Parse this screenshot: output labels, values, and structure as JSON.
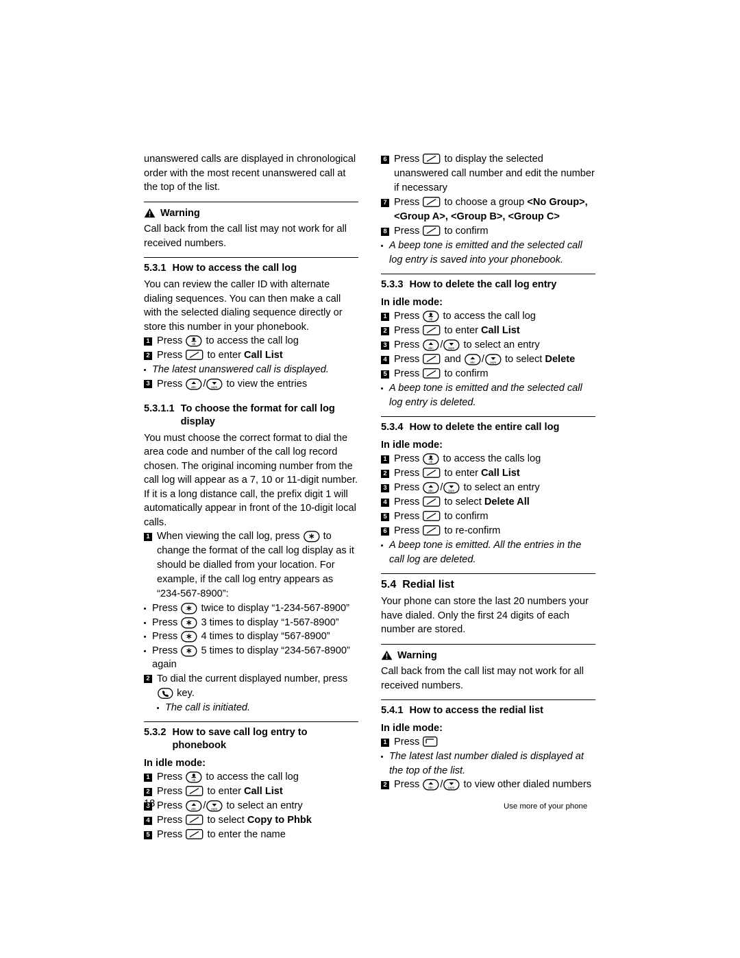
{
  "page": {
    "number": "18",
    "footer_text": "Use more of your phone"
  },
  "left_column": {
    "intro": "unanswered calls are displayed in chronological order with the most recent unanswered call at the top of the list.",
    "warning1": {
      "label": "Warning",
      "text": "Call back from the call list may not work for all received numbers."
    },
    "s531": {
      "number": "5.3.1",
      "title": "How to access the call log",
      "body": "You can review the caller ID with alternate dialing sequences. You can then make a call with the selected dialing sequence directly or store this number in your phonebook.",
      "steps": [
        {
          "n": "1",
          "pre": "Press",
          "icon": "phonebook-key",
          "post": "to access the call log"
        },
        {
          "n": "2",
          "pre": "Press",
          "icon": "right-soft-key",
          "post": "to enter",
          "bold": "Call List"
        },
        {
          "n": "3",
          "pre": "Press",
          "icon": "up-down-key",
          "post": "to view the entries"
        }
      ],
      "bullet": "The latest unanswered call is displayed."
    },
    "s5311": {
      "number": "5.3.1.1",
      "title": "To choose the format for call log display",
      "body": "You must choose the correct format to dial the area code and number of the call log record chosen. The original incoming number from the call log will appear as a 7, 10 or 11-digit number. If it is a long distance call, the prefix digit 1 will automatically appear in front of the 10-digit local calls.",
      "step1": {
        "n": "1",
        "pre": "When viewing the call log, press",
        "icon": "star-key",
        "post": "to change the format of the call log display as it should be dialled from your location. For example, if the call log entry appears as “234-567-8900”:"
      },
      "format_bullets": [
        {
          "pre": "Press",
          "icon": "star-key",
          "post": "twice to display “1-234-567-8900”"
        },
        {
          "pre": "Press",
          "icon": "star-key",
          "post": "3 times to display “1-567-8900”"
        },
        {
          "pre": "Press",
          "icon": "star-key",
          "post": "4 times to display “567-8900”"
        },
        {
          "pre": "Press",
          "icon": "star-key",
          "post": "5 times to display “234-567-8900” again"
        }
      ],
      "step2": {
        "n": "2",
        "pre": "To dial the current displayed number, press",
        "icon": "talk-key",
        "post": "key."
      },
      "sub_bullet": "The call is initiated."
    },
    "s532": {
      "number": "5.3.2",
      "title": "How to save call log entry to phonebook",
      "idle": "In idle mode:",
      "steps": [
        {
          "n": "1",
          "pre": "Press",
          "icon": "phonebook-key",
          "post": "to access the call log"
        },
        {
          "n": "2",
          "pre": "Press",
          "icon": "right-soft-key",
          "post": "to enter",
          "bold": "Call List"
        },
        {
          "n": "3",
          "pre": "Press",
          "icon": "up-down-key",
          "post": "to select an entry"
        },
        {
          "n": "4",
          "pre": "Press",
          "icon": "right-soft-key",
          "post": "to select",
          "bold": "Copy to Phbk"
        },
        {
          "n": "5",
          "pre": "Press",
          "icon": "right-soft-key",
          "post": "to enter the name"
        }
      ]
    }
  },
  "right_column": {
    "continued_steps": [
      {
        "n": "6",
        "pre": "Press",
        "icon": "right-soft-key",
        "post": "to display the selected unanswered call number and edit the number if necessary"
      },
      {
        "n": "7",
        "pre": "Press",
        "icon": "right-soft-key",
        "post": "to choose a group ",
        "bold_seq": "<No Group>, <Group A>, <Group B>, <Group C>"
      },
      {
        "n": "8",
        "pre": "Press",
        "icon": "right-soft-key",
        "post": "to confirm"
      }
    ],
    "bullet_after": "A beep tone is emitted and the selected call log entry is saved into your phonebook.",
    "s533": {
      "number": "5.3.3",
      "title": "How to delete the call log entry",
      "idle": "In idle mode:",
      "steps": [
        {
          "n": "1",
          "pre": "Press",
          "icon": "phonebook-key",
          "post": "to access the call log"
        },
        {
          "n": "2",
          "pre": "Press",
          "icon": "right-soft-key",
          "post": "to enter",
          "bold": "Call List"
        },
        {
          "n": "3",
          "pre": "Press",
          "icon": "up-down-key",
          "post": "to select an entry"
        },
        {
          "n": "4",
          "pre": "Press",
          "icon": "right-soft-key",
          "mid": "and",
          "icon2": "up-down-key",
          "post": "to select",
          "bold": "Delete"
        },
        {
          "n": "5",
          "pre": "Press",
          "icon": "right-soft-key",
          "post": "to confirm"
        }
      ],
      "bullet": "A beep tone is emitted and the selected call log entry is deleted."
    },
    "s534": {
      "number": "5.3.4",
      "title": "How to delete the entire call log",
      "idle": "In idle mode:",
      "steps": [
        {
          "n": "1",
          "pre": "Press",
          "icon": "phonebook-key",
          "post": "to access the calls log"
        },
        {
          "n": "2",
          "pre": "Press",
          "icon": "right-soft-key",
          "post": "to enter",
          "bold": "Call List"
        },
        {
          "n": "3",
          "pre": "Press",
          "icon": "up-down-key",
          "post": "to select an entry"
        },
        {
          "n": "4",
          "pre": "Press",
          "icon": "right-soft-key",
          "post": "to select",
          "bold": "Delete All"
        },
        {
          "n": "5",
          "pre": "Press",
          "icon": "right-soft-key",
          "post": "to confirm"
        },
        {
          "n": "6",
          "pre": "Press",
          "icon": "right-soft-key",
          "post": "to re-confirm"
        }
      ],
      "bullet": "A beep tone is emitted. All the entries in the call log are deleted."
    },
    "s54": {
      "number": "5.4",
      "title": "Redial list",
      "body": "Your phone can store the last 20 numbers your have dialed. Only the first 24 digits of each number are stored."
    },
    "warning2": {
      "label": "Warning",
      "text": "Call back from the call list may not work for all received numbers."
    },
    "s541": {
      "number": "5.4.1",
      "title": "How to access the redial list",
      "idle": "In idle mode:",
      "step1": {
        "n": "1",
        "pre": "Press",
        "icon": "redial-key",
        "post": ""
      },
      "bullet": "The latest last number dialed is displayed at the top of the list.",
      "step2": {
        "n": "2",
        "pre": "Press",
        "icon": "up-down-key",
        "post": "to view other dialed numbers"
      }
    }
  }
}
